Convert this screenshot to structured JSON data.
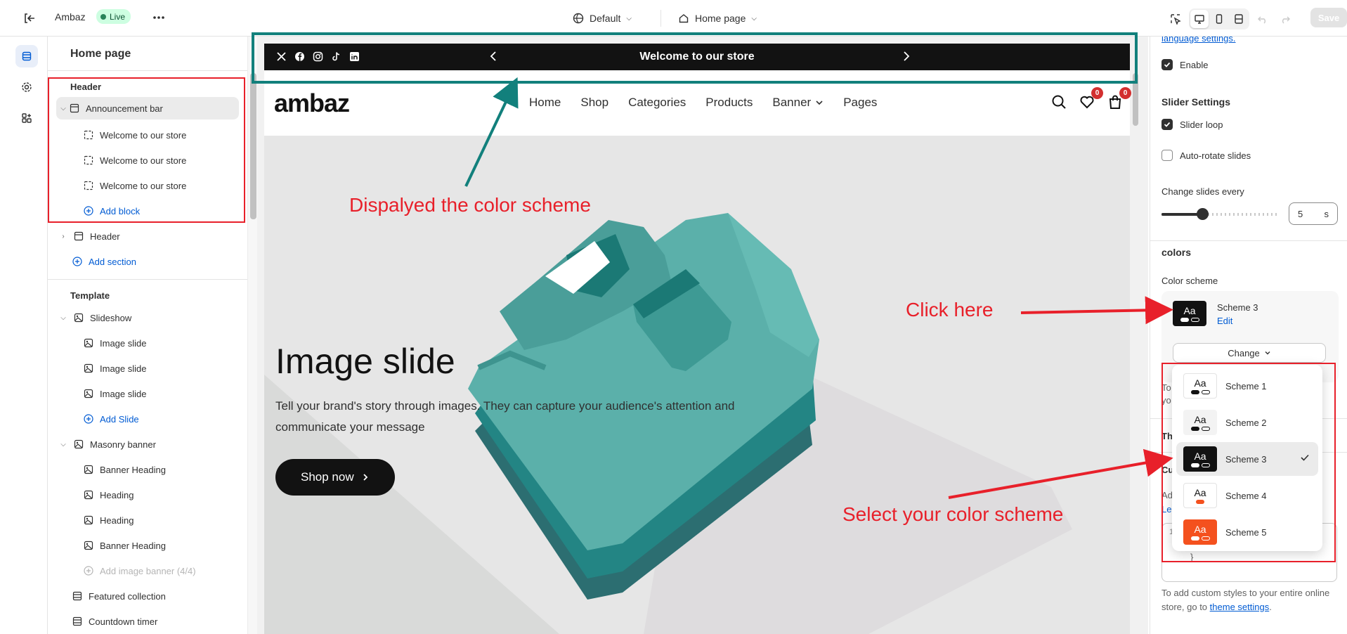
{
  "topbar": {
    "store_name": "Ambaz",
    "live_label": "Live",
    "theme_label": "Default",
    "page_label": "Home page",
    "save_label": "Save"
  },
  "sidebar": {
    "title": "Home page",
    "header_group_label": "Header",
    "announcement_bar_label": "Announcement bar",
    "announcement_blocks": [
      "Welcome to our store",
      "Welcome to our store",
      "Welcome to our store"
    ],
    "add_block_label": "Add block",
    "header_section_label": "Header",
    "add_section_label": "Add section",
    "template_label": "Template",
    "slideshow_label": "Slideshow",
    "slides": [
      "Image slide",
      "Image slide",
      "Image slide"
    ],
    "add_slide_label": "Add Slide",
    "masonry_label": "Masonry banner",
    "masonry_blocks": [
      "Banner Heading",
      "Heading",
      "Heading",
      "Banner Heading"
    ],
    "add_image_banner_label": "Add image banner (4/4)",
    "featured_collection_label": "Featured collection",
    "countdown_label": "Countdown timer"
  },
  "preview": {
    "announcement_text": "Welcome to our store",
    "logo_text": "ambaz",
    "nav": [
      "Home",
      "Shop",
      "Categories",
      "Products",
      "Banner",
      "Pages"
    ],
    "wishlist_count": "0",
    "cart_count": "0",
    "hero_title": "Image slide",
    "hero_text": "Tell your brand's story through images. They can capture your audience's attention and communicate your message",
    "hero_button": "Shop now"
  },
  "right_panel": {
    "language_link": "language settings.",
    "enable_label": "Enable",
    "slider_settings_heading": "Slider Settings",
    "slider_loop_label": "Slider loop",
    "auto_rotate_label": "Auto-rotate slides",
    "change_slides_label": "Change slides every",
    "change_slides_value": "5",
    "change_slides_unit": "s",
    "slide_interval_seconds": 5,
    "colors_heading": "colors",
    "color_scheme_label": "Color scheme",
    "current_scheme": "Scheme 3",
    "edit_label": "Edit",
    "change_label": "Change",
    "hidden_fragments": [
      "To",
      "yo",
      "Th",
      "Cu",
      "Ad",
      "Le",
      "1",
      "}"
    ],
    "custom_css_note": "To add custom styles to your entire online store, go to",
    "theme_settings_link": "theme settings",
    "period": "."
  },
  "scheme_dropdown": {
    "swatch_text": "Aa",
    "options": [
      {
        "label": "Scheme 1",
        "bg": "#ffffff",
        "fg": "#121212",
        "pill": "#121212",
        "selected": false
      },
      {
        "label": "Scheme 2",
        "bg": "#f3f3f3",
        "fg": "#121212",
        "pill": "#121212",
        "selected": false
      },
      {
        "label": "Scheme 3",
        "bg": "#121212",
        "fg": "#ffffff",
        "pill": "#ffffff",
        "selected": true
      },
      {
        "label": "Scheme 4",
        "bg": "#ffffff",
        "fg": "#121212",
        "pill": "#f4511e",
        "selected": false
      },
      {
        "label": "Scheme 5",
        "bg": "#f4511e",
        "fg": "#ffffff",
        "pill": "#ffffff",
        "selected": false
      }
    ]
  },
  "annotations": {
    "displayed_label": "Dispalyed the color scheme",
    "click_here_label": "Click here",
    "select_label": "Select your color scheme"
  },
  "colors": {
    "accent_blue": "#005bd3",
    "annotation_red": "#e8202a",
    "annotation_teal": "#12807c",
    "shirt_teal": "#5bb0aa"
  }
}
